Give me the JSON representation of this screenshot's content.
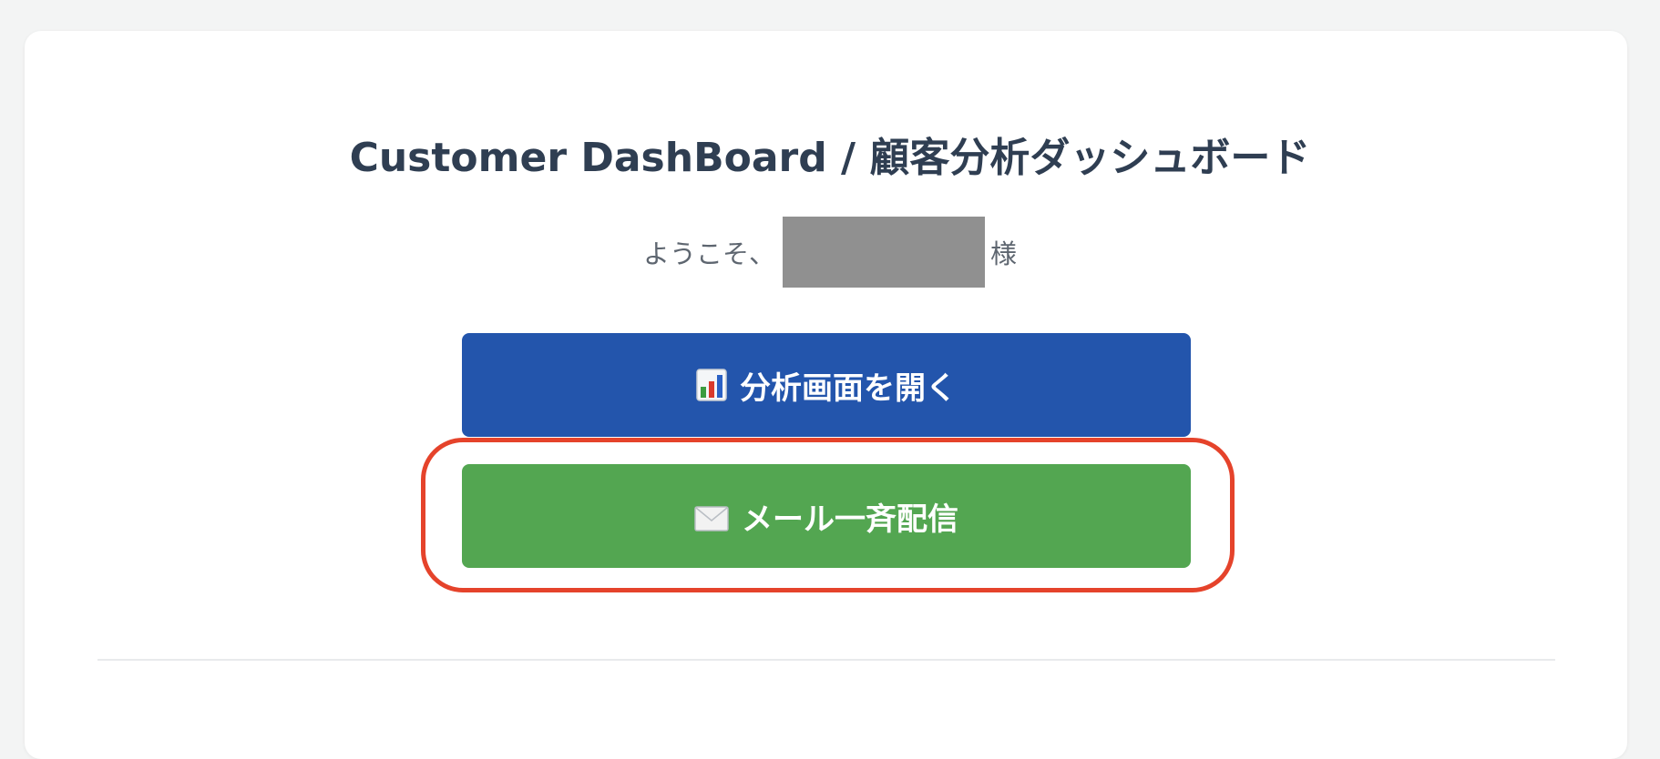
{
  "header": {
    "title": "Customer DashBoard / 顧客分析ダッシュボード"
  },
  "welcome": {
    "prefix": "ようこそ、",
    "suffix": "様"
  },
  "actions": {
    "analysis_label": "分析画面を開く",
    "analysis_icon": "bar-chart-icon",
    "mail_label": "メール一斉配信",
    "mail_icon": "envelope-icon"
  },
  "colors": {
    "primary_blue": "#2355ac",
    "success_green": "#53a651",
    "highlight_red": "#e5432b",
    "title_text": "#2f3e52"
  }
}
